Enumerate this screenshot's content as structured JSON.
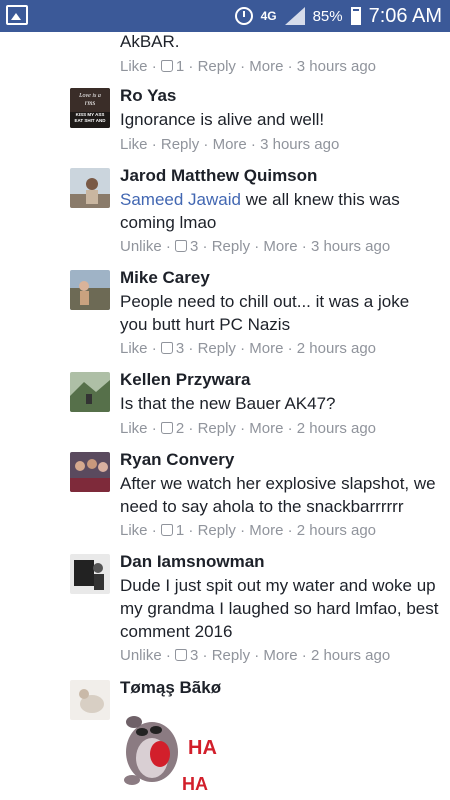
{
  "status": {
    "network": "4G",
    "battery": "85%",
    "time": "7:06 AM"
  },
  "comments": [
    {
      "name": "",
      "text": "AkBAR.",
      "actions": [
        "Like",
        "1",
        "Reply",
        "More",
        "3 hours ago"
      ]
    },
    {
      "name": "Ro Yas",
      "text": "Ignorance is alive and well!",
      "actions": [
        "Like",
        "",
        "Reply",
        "More",
        "3 hours ago"
      ]
    },
    {
      "name": "Jarod Matthew Quimson",
      "mention": "Sameed Jawaid",
      "text": " we all knew this was coming lmao",
      "actions": [
        "Unlike",
        "3",
        "Reply",
        "More",
        "3 hours ago"
      ]
    },
    {
      "name": "Mike Carey",
      "text": "People need to chill out... it was a joke you butt hurt PC Nazis",
      "actions": [
        "Like",
        "3",
        "Reply",
        "More",
        "2 hours ago"
      ]
    },
    {
      "name": "Kellen Przywara",
      "text": "Is that the new Bauer AK47?",
      "actions": [
        "Like",
        "2",
        "Reply",
        "More",
        "2 hours ago"
      ]
    },
    {
      "name": "Ryan Convery",
      "text": "After we watch her explosive slapshot, we need to say ahola to the snackbarrrrrr",
      "actions": [
        "Like",
        "1",
        "Reply",
        "More",
        "2 hours ago"
      ]
    },
    {
      "name": "Dan Iamsnowman",
      "text": "Dude I just spit out my water and woke up my grandma I laughed so hard lmfao, best comment 2016",
      "actions": [
        "Unlike",
        "3",
        "Reply",
        "More",
        "2 hours ago"
      ]
    },
    {
      "name": "Tømąş Bãkø",
      "text": "",
      "actions": []
    }
  ],
  "sticker": {
    "line1": "HA",
    "line2": "HA"
  },
  "avatar_text": {
    "ro_yas": [
      "Love is a",
      "rms",
      "KISS MY ASS",
      "EAT SHIT AND"
    ]
  }
}
